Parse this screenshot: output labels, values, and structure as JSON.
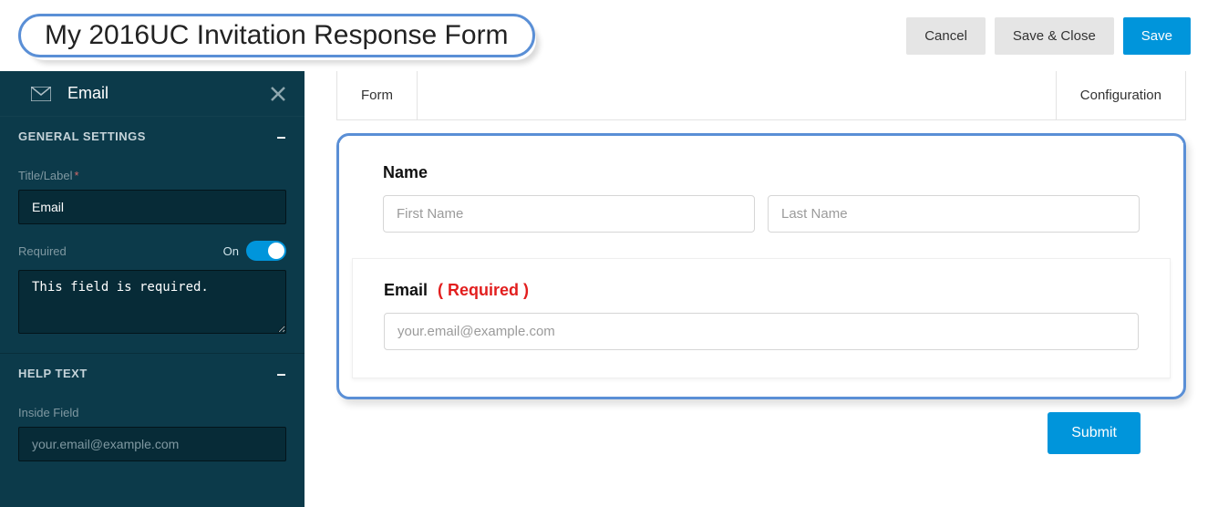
{
  "header": {
    "title": "My 2016UC Invitation Response Form",
    "cancel_label": "Cancel",
    "save_close_label": "Save & Close",
    "save_label": "Save"
  },
  "sidebar": {
    "panel_title": "Email",
    "section_general": "GENERAL SETTINGS",
    "title_label_text": "Title/Label",
    "title_value": "Email",
    "required_label": "Required",
    "toggle_state": "On",
    "required_message": "This field is required.",
    "section_help": "HELP TEXT",
    "inside_field_label": "Inside Field",
    "inside_field_value": "your.email@example.com"
  },
  "tabs": {
    "form_label": "Form",
    "config_label": "Configuration"
  },
  "preview": {
    "name_label": "Name",
    "first_placeholder": "First Name",
    "last_placeholder": "Last Name",
    "email_label": "Email",
    "required_tag": "( Required )",
    "email_placeholder": "your.email@example.com",
    "submit_label": "Submit"
  }
}
